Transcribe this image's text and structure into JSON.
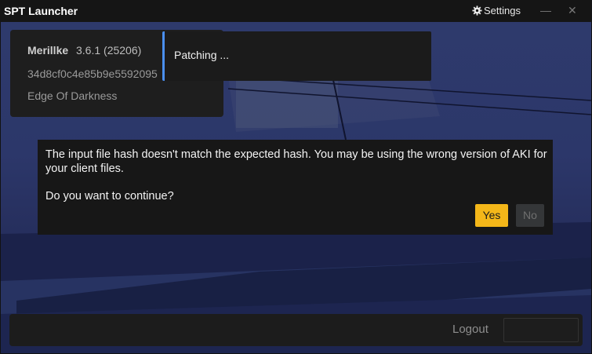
{
  "window": {
    "title": "SPT Launcher",
    "settings_label": "Settings",
    "minimize_symbol": "—",
    "close_symbol": "✕"
  },
  "profile": {
    "username": "Merillke",
    "version": "3.6.1 (25206)",
    "profile_id": "34d8cf0c4e85b9e5592095",
    "edition": "Edge Of Darkness"
  },
  "status": {
    "text": "Patching ..."
  },
  "dialog": {
    "message": "The input file hash doesn't match the expected hash. You may be using the wrong version of AKI for your client files.",
    "question": "Do you want to continue?",
    "yes_label": "Yes",
    "no_label": "No"
  },
  "footer": {
    "logout_label": "Logout"
  },
  "colors": {
    "accent": "#f4b719",
    "status_bar": "#4a8ff0"
  },
  "icons": {
    "settings": "gear-icon"
  }
}
